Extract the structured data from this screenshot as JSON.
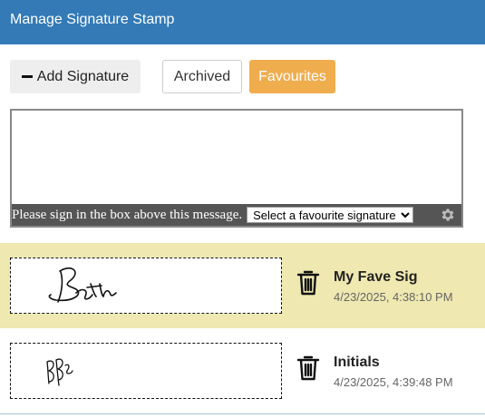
{
  "header": {
    "title": "Manage Signature Stamp"
  },
  "toolbar": {
    "add_label": "Add Signature",
    "archived_label": "Archived",
    "favourites_label": "Favourites"
  },
  "signature_pad": {
    "message": "Please sign in the box above this message.",
    "select_value": "Select a favourite signature"
  },
  "colors": {
    "header": "#337ab7",
    "favourites": "#f0ad4e",
    "highlight_row": "#efe8b0"
  },
  "signatures": [
    {
      "name": "My Fave Sig",
      "date": "4/23/2025, 4:38:10 PM"
    },
    {
      "name": "Initials",
      "date": "4/23/2025, 4:39:48 PM"
    }
  ]
}
